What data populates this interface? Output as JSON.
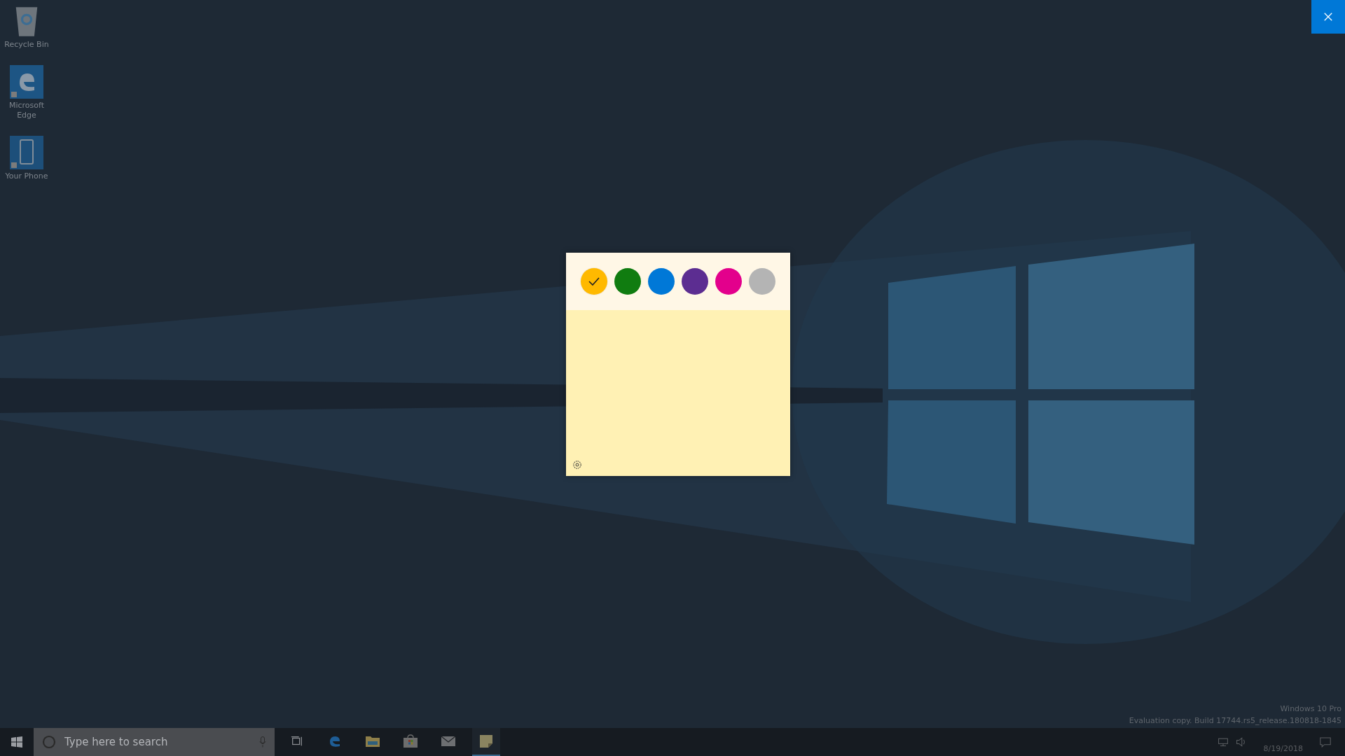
{
  "desktop_icons": [
    {
      "kind": "recycle-bin",
      "label": "Recycle Bin"
    },
    {
      "kind": "edge",
      "label": "Microsoft Edge"
    },
    {
      "kind": "phone",
      "label": "Your Phone"
    }
  ],
  "note": {
    "colors": [
      {
        "color": "#ffb900",
        "selected": true
      },
      {
        "color": "#107c10",
        "selected": false
      },
      {
        "color": "#0078d7",
        "selected": false
      },
      {
        "color": "#5c2d91",
        "selected": false
      },
      {
        "color": "#e3008c",
        "selected": false
      },
      {
        "color": "#b4b4b4",
        "selected": false
      }
    ]
  },
  "taskbar": {
    "search": {
      "placeholder": "Type here to search"
    },
    "apps": [
      {
        "kind": "task-view",
        "active": false
      },
      {
        "kind": "edge",
        "active": false
      },
      {
        "kind": "folder",
        "active": false
      },
      {
        "kind": "store",
        "active": false
      },
      {
        "kind": "mail",
        "active": false
      },
      {
        "kind": "sticky-notes",
        "active": true
      }
    ],
    "date": "8/19/2018"
  },
  "evaluation_notice": {
    "edition": "Windows 10 Pro",
    "build": "Evaluation copy. Build 17744.rs5_release.180818-1845"
  }
}
